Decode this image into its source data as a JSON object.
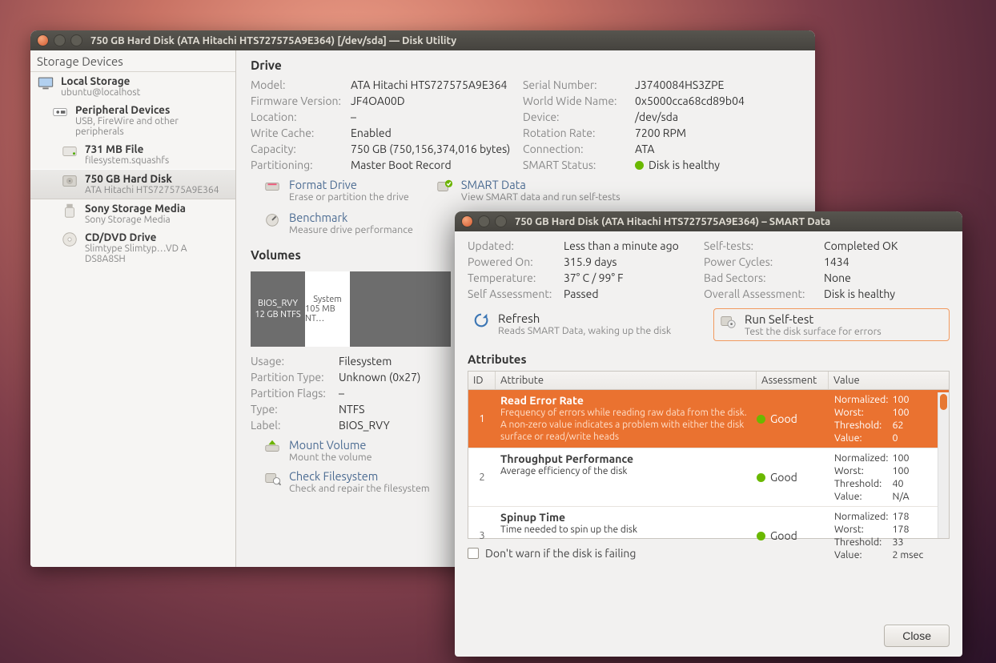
{
  "win1": {
    "title": "750 GB Hard Disk (ATA Hitachi HTS727575A9E364) [/dev/sda] — Disk Utility",
    "sidebar_head": "Storage Devices",
    "devices": [
      {
        "l1": "Local Storage",
        "l2": "ubuntu@localhost"
      },
      {
        "l1": "Peripheral Devices",
        "l2": "USB, FireWire and other peripherals"
      },
      {
        "l1": "731 MB File",
        "l2": "filesystem.squashfs"
      },
      {
        "l1": "750 GB Hard Disk",
        "l2": "ATA Hitachi HTS727575A9E364"
      },
      {
        "l1": "Sony Storage Media",
        "l2": "Sony Storage Media"
      },
      {
        "l1": "CD/DVD Drive",
        "l2": "Slimtype Slimtyp…VD A  DS8A8SH"
      }
    ],
    "drive_head": "Drive",
    "drive": {
      "model_k": "Model:",
      "model_v": "ATA Hitachi HTS727575A9E364",
      "serial_k": "Serial Number:",
      "serial_v": "J3740084HS3ZPE",
      "fw_k": "Firmware Version:",
      "fw_v": "JF4OA00D",
      "wwn_k": "World Wide Name:",
      "wwn_v": "0x5000cca68cd89b04",
      "loc_k": "Location:",
      "loc_v": "–",
      "dev_k": "Device:",
      "dev_v": "/dev/sda",
      "wc_k": "Write Cache:",
      "wc_v": "Enabled",
      "rot_k": "Rotation Rate:",
      "rot_v": "7200 RPM",
      "cap_k": "Capacity:",
      "cap_v": "750 GB (750,156,374,016 bytes)",
      "conn_k": "Connection:",
      "conn_v": "ATA",
      "part_k": "Partitioning:",
      "part_v": "Master Boot Record",
      "smart_k": "SMART Status:",
      "smart_v": "Disk is healthy"
    },
    "actions": {
      "format_t": "Format Drive",
      "format_d": "Erase or partition the drive",
      "smart_t": "SMART Data",
      "smart_d": "View SMART data and run self-tests",
      "bench_t": "Benchmark",
      "bench_d": "Measure drive performance"
    },
    "volumes_head": "Volumes",
    "volumes": {
      "v1_l1": "BIOS_RVY",
      "v1_l2": "12 GB NTFS",
      "v2_l1": "System",
      "v2_l2": "105 MB NT…"
    },
    "vdet": {
      "usage_k": "Usage:",
      "usage_v": "Filesystem",
      "pt_k": "Partition Type:",
      "pt_v": "Unknown (0x27)",
      "pf_k": "Partition Flags:",
      "pf_v": "–",
      "type_k": "Type:",
      "type_v": "NTFS",
      "label_k": "Label:",
      "label_v": "BIOS_RVY"
    },
    "vactions": {
      "mount_t": "Mount Volume",
      "mount_d": "Mount the volume",
      "check_t": "Check Filesystem",
      "check_d": "Check and repair the filesystem"
    }
  },
  "win2": {
    "title": "750 GB Hard Disk (ATA Hitachi HTS727575A9E364) – SMART Data",
    "top": {
      "upd_k": "Updated:",
      "upd_v": "Less than a minute ago",
      "st_k": "Self-tests:",
      "st_v": "Completed OK",
      "pow_k": "Powered On:",
      "pow_v": "315.9 days",
      "pc_k": "Power Cycles:",
      "pc_v": "1434",
      "temp_k": "Temperature:",
      "temp_v": "37° C / 99° F",
      "bad_k": "Bad Sectors:",
      "bad_v": "None",
      "sa_k": "Self Assessment:",
      "sa_v": "Passed",
      "oa_k": "Overall Assessment:",
      "oa_v": "Disk is healthy"
    },
    "act": {
      "refresh_t": "Refresh",
      "refresh_d": "Reads SMART Data, waking up the disk",
      "selftest_t": "Run Self-test",
      "selftest_d": "Test the disk surface for errors"
    },
    "attr_head": "Attributes",
    "hdr": {
      "id": "ID",
      "attr": "Attribute",
      "ass": "Assessment",
      "val": "Value"
    },
    "val_labels": {
      "norm": "Normalized:",
      "worst": "Worst:",
      "thresh": "Threshold:",
      "value": "Value:"
    },
    "rows": [
      {
        "id": "1",
        "name": "Read Error Rate",
        "desc": "Frequency of errors while reading raw data from the disk. A non-zero value indicates a problem with either the disk surface or read/write heads",
        "ass": "Good",
        "norm": "100",
        "worst": "100",
        "thresh": "62",
        "value": "0",
        "sel": true
      },
      {
        "id": "2",
        "name": "Throughput Performance",
        "desc": "Average efficiency of the disk",
        "ass": "Good",
        "norm": "100",
        "worst": "100",
        "thresh": "40",
        "value": "N/A"
      },
      {
        "id": "3",
        "name": "Spinup Time",
        "desc": "Time needed to spin up the disk",
        "ass": "Good",
        "norm": "178",
        "worst": "178",
        "thresh": "33",
        "value": "2 msec"
      }
    ],
    "warn": "Don't warn if the disk is failing",
    "close": "Close"
  }
}
